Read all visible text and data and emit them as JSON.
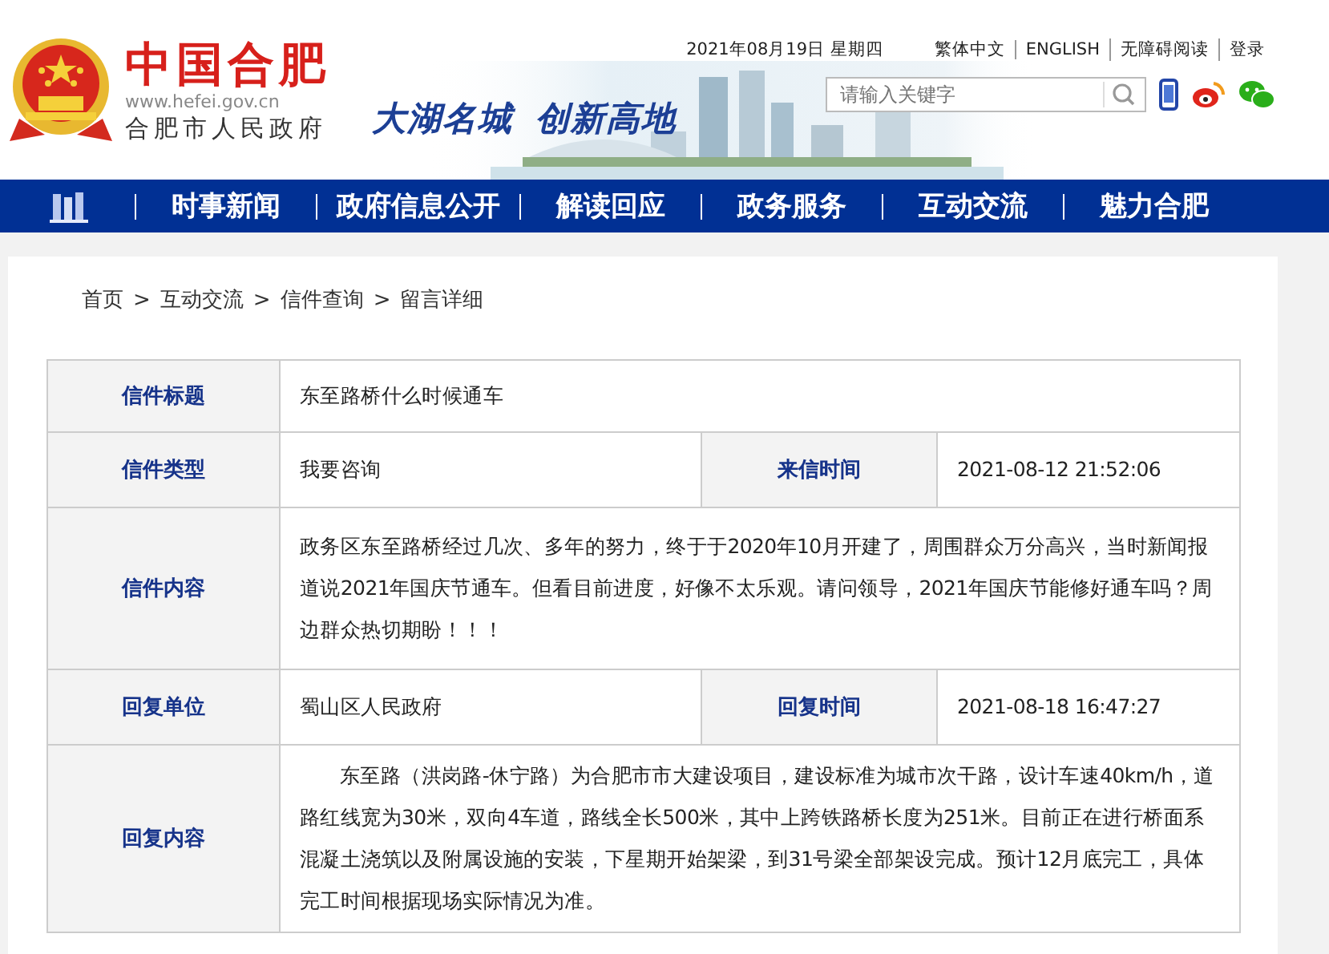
{
  "header": {
    "site_title": "中国合肥",
    "site_url": "www.hefei.gov.cn",
    "site_subtitle": "合肥市人民政府",
    "slogan": [
      "大湖名城",
      "创新高地"
    ],
    "date": "2021年08月19日 星期四",
    "top_links": [
      "繁体中文",
      "ENGLISH",
      "无障碍阅读",
      "登录"
    ],
    "search": {
      "placeholder": "请输入关键字"
    }
  },
  "nav": {
    "items": [
      "时事新闻",
      "政府信息公开",
      "解读回应",
      "政务服务",
      "互动交流",
      "魅力合肥"
    ]
  },
  "breadcrumb": [
    {
      "label": "首页",
      "separator": ">"
    },
    {
      "label": "互动交流",
      "separator": ">"
    },
    {
      "label": "信件查询",
      "separator": ">"
    },
    {
      "label": "留言详细"
    }
  ],
  "letter": {
    "rows": [
      {
        "kind": "single",
        "fields": [
          {
            "label": "信件标题",
            "value": "东至路桥什么时候通车"
          }
        ]
      },
      {
        "kind": "pair",
        "fields": [
          {
            "label": "信件类型",
            "value": "我要咨询"
          },
          {
            "label": "来信时间",
            "value": "2021-08-12 21:52:06"
          }
        ]
      },
      {
        "kind": "text",
        "fields": [
          {
            "label": "信件内容",
            "value": "政务区东至路桥经过几次、多年的努力，终于于2020年10月开建了，周围群众万分高兴，当时新闻报道说2021年国庆节通车。但看目前进度，好像不太乐观。请问领导，2021年国庆节能修好通车吗？周边群众热切期盼！！！",
            "indent": false
          }
        ]
      },
      {
        "kind": "pair",
        "fields": [
          {
            "label": "回复单位",
            "value": "蜀山区人民政府"
          },
          {
            "label": "回复时间",
            "value": "2021-08-18 16:47:27"
          }
        ]
      },
      {
        "kind": "text",
        "fields": [
          {
            "label": "回复内容",
            "value": "东至路（洪岗路-休宁路）为合肥市市大建设项目，建设标准为城市次干路，设计车速40km/h，道路红线宽为30米，双向4车道，路线全长500米，其中上跨铁路桥长度为251米。目前正在进行桥面系混凝土浇筑以及附属设施的安装，下星期开始架梁，到31号梁全部架设完成。预计12月底完工，具体完工时间根据现场实际情况为准。",
            "indent": true
          }
        ]
      }
    ]
  }
}
